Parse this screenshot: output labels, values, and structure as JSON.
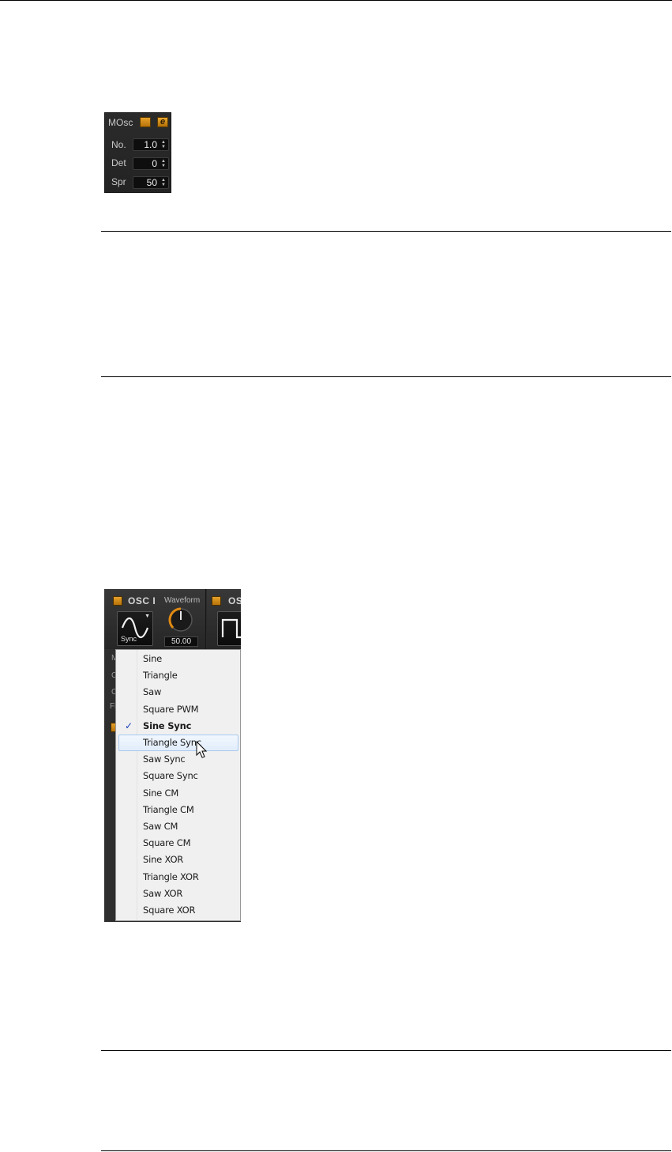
{
  "mosc_panel": {
    "title": "MOsc",
    "rows": [
      {
        "label": "No.",
        "value": "1.0"
      },
      {
        "label": "Det",
        "value": "0"
      },
      {
        "label": "Spr",
        "value": "50"
      }
    ],
    "accent_color": "#d98c1a"
  },
  "osc_panel": {
    "title": "OSC I",
    "second_title": "OS",
    "waveform_label": "Waveform",
    "waveform_button_label": "Sync",
    "waveform_value": "50.00",
    "knob_level": 0.5,
    "ghost_labels": [
      "M",
      "C",
      "C",
      "Fi"
    ]
  },
  "waveform_menu": {
    "items": [
      "Sine",
      "Triangle",
      "Saw",
      "Square PWM",
      "Sine Sync",
      "Triangle Sync",
      "Saw Sync",
      "Square Sync",
      "Sine CM",
      "Triangle CM",
      "Saw CM",
      "Square CM",
      "Sine XOR",
      "Triangle XOR",
      "Saw XOR",
      "Square XOR"
    ],
    "selected": "Sine Sync",
    "hovered": "Triangle Sync",
    "check_glyph": "✓"
  }
}
